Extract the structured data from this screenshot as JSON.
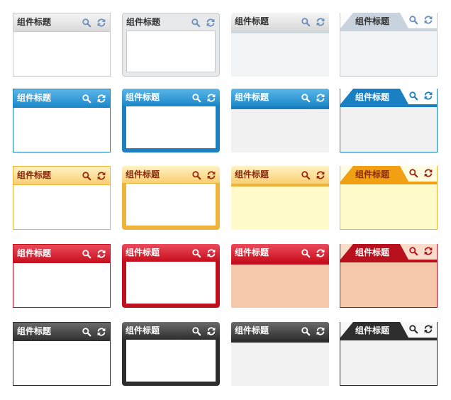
{
  "title": "组件标题",
  "icons": [
    "search-icon",
    "refresh-icon"
  ],
  "themes": [
    {
      "name": "gray",
      "hdr": [
        "#f5f5f5",
        "#d9d9d9"
      ],
      "text": "#333333",
      "icon": "#6b8fbe",
      "border": "#c9c9c9",
      "bodyFill": "#f2f3f4",
      "light": "#fcfcfc",
      "tab": "#c9d3dd"
    },
    {
      "name": "blue",
      "hdr": [
        "#5cb6e8",
        "#1b88c9"
      ],
      "text": "#ffffff",
      "icon": "#ffffff",
      "border": "#1b7fc0",
      "bodyFill": "#f1f1f1",
      "light": "#ffffff",
      "tab": "#1a80c4"
    },
    {
      "name": "yellow",
      "hdr": [
        "#fff2c4",
        "#f9cf72"
      ],
      "text": "#8a2a0c",
      "icon": "#9a2a10",
      "border": "#efb23b",
      "bodyFill": "#fffbca",
      "light": "#fffce4",
      "tab": "#f0a012"
    },
    {
      "name": "red",
      "hdr": [
        "#ec4a5c",
        "#c8101e"
      ],
      "text": "#ffffff",
      "icon": "#ffffff",
      "border": "#c01020",
      "bodyFill": "#f5c7ab",
      "light": "#fadccb",
      "tab": "#b8101c"
    },
    {
      "name": "black",
      "hdr": [
        "#6a6a6a",
        "#303030"
      ],
      "text": "#ffffff",
      "icon": "#ffffff",
      "border": "#2d2d2d",
      "bodyFill": "#f2f2f2",
      "light": "#f8f8f8",
      "tab": "#2e2e2e"
    }
  ]
}
